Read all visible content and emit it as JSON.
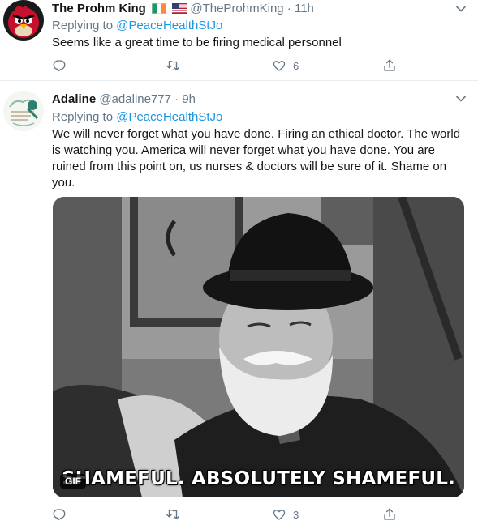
{
  "tweets": [
    {
      "display_name": "The Prohm King",
      "flags": [
        "Ireland flag",
        "US flag"
      ],
      "handle": "@TheProhmKing",
      "separator": "·",
      "time": "11h",
      "replying_prefix": "Replying to",
      "replying_to": "@PeaceHealthStJo",
      "text": "Seems like a great time to be firing medical personnel",
      "reply_count": "",
      "retweet_count": "",
      "like_count": "6"
    },
    {
      "display_name": "Adaline",
      "handle": "@adaline777",
      "separator": "·",
      "time": "9h",
      "replying_prefix": "Replying to",
      "replying_to": "@PeaceHealthStJo",
      "text": "We will never forget what you have done. Firing an ethical doctor. The world is watching you. America will never forget what you have done. You are ruined from this point on, us nurses & doctors will be sure of it. Shame on you.",
      "media": {
        "caption": "SHAMEFUL. ABSOLUTELY SHAMEFUL.",
        "badge": "GIF"
      },
      "reply_count": "",
      "retweet_count": "",
      "like_count": "3"
    }
  ],
  "icons": [
    "reply-icon",
    "retweet-icon",
    "like-icon",
    "share-icon",
    "chevron-down-icon"
  ],
  "colors": {
    "link": "#1b95e0",
    "secondary_text": "#657786",
    "divider": "#e6ecf0"
  }
}
